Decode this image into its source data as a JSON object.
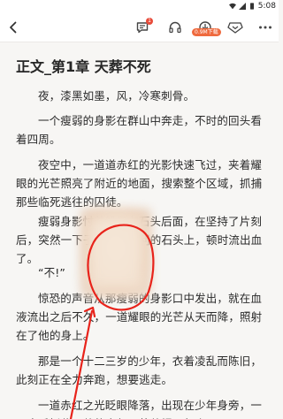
{
  "status_bar": {
    "time": "5:08"
  },
  "top_bar": {
    "back_icon": "chevron-left-icon",
    "icons": [
      "comment-icon",
      "headphones-icon",
      "download-icon",
      "reward-icon",
      "more-icon"
    ],
    "download_pill": "0.9M下载",
    "comment_badge": "1"
  },
  "chapter": {
    "title": "正文_第1章 天葬不死",
    "paragraphs": [
      "夜，漆黑如墨，风，冷寒刺骨。",
      "一个瘦弱的身影在群山中奔走，不时的回头看着四周。",
      "夜空中，一道道赤红的光影快速飞过，夹着耀眼的光芒照亮了附近的地面，搜索整个区域，抓捕那些临死逃往的囚徒。",
      "瘦弱身影忖着躲闪在石头后面，在坚持了片刻后，突然一下子跌倒在锋利的石头上，顿时流出血了。",
      "“不!”",
      "惊恐的声音从那瘦弱的身影口中发出，就在血液流出之后不久，一道耀眼的光芒从天而降，照射在了他的身上。",
      "那是一个十二三岁的少年，衣着凌乱而陈旧，此刻正在全力奔跑，想要逃走。",
      "一道赤红之光眨眼降落，出现在少年身旁，一只大手抓住了他的衣领，将他提了起来。"
    ]
  },
  "annotation": {
    "color": "#e8231b"
  }
}
